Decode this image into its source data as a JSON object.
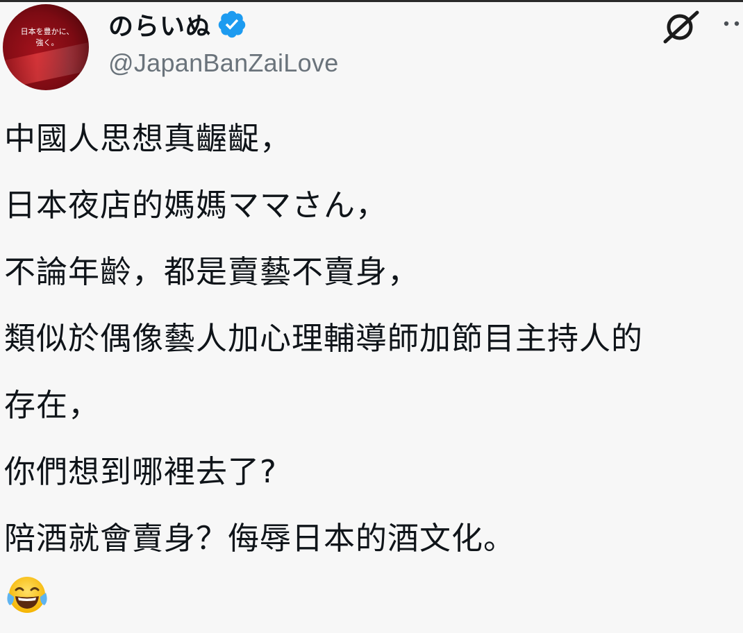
{
  "user": {
    "display_name": "のらいぬ",
    "handle": "@JapanBanZaiLove",
    "avatar_text": [
      "日本を豊かに、",
      "強く。"
    ],
    "verified": true
  },
  "icons": {
    "verified": "verified-badge-icon",
    "grok": "grok-icon",
    "more": "more-options-icon",
    "emoji": "face-with-tears-of-joy"
  },
  "colors": {
    "background": "#f7f7f7",
    "text": "#0f1419",
    "handle": "#6a737b",
    "verified_blue": "#1d9bf0"
  },
  "post": {
    "lines": [
      "中國人思想真齷齪，",
      "日本夜店的媽媽ママさん，",
      "不論年齡，都是賣藝不賣身，",
      "類似於偶像藝人加心理輔導師加節目主持人的",
      "存在，",
      "你們想到哪裡去了?",
      "陪酒就會賣身？侮辱日本的酒文化。"
    ]
  }
}
